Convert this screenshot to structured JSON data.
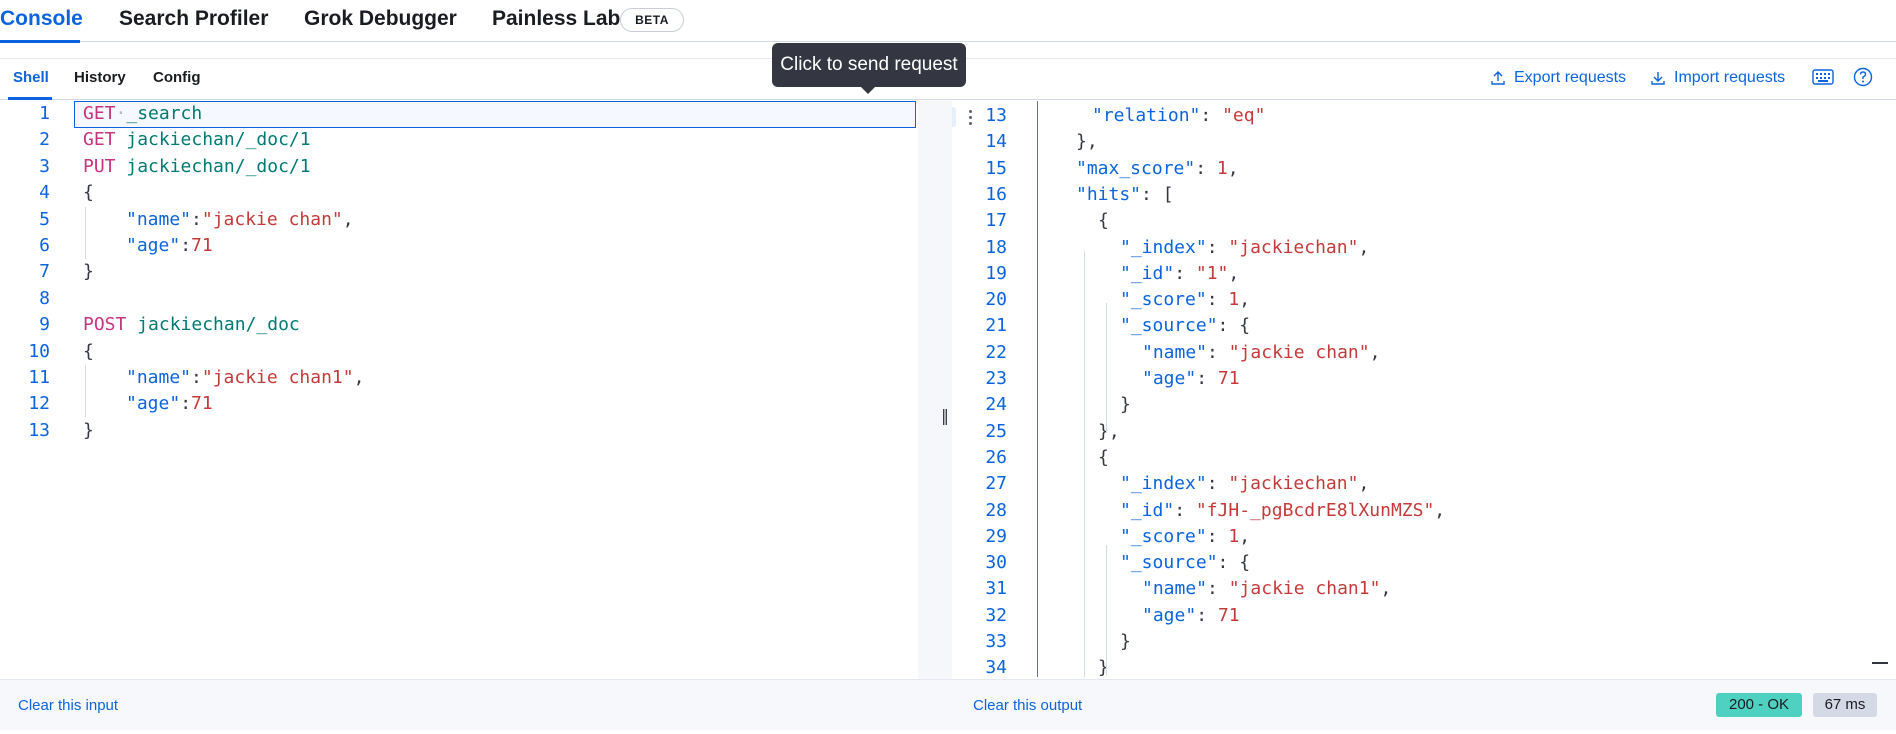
{
  "top_tabs": {
    "console": "Console",
    "search_profiler": "Search Profiler",
    "grok_debugger": "Grok Debugger",
    "painless_lab": "Painless Lab",
    "beta": "BETA"
  },
  "sub_tabs": {
    "shell": "Shell",
    "history": "History",
    "config": "Config"
  },
  "actions": {
    "export": "Export requests",
    "import": "Import requests",
    "keyboard_icon": "keyboard-icon",
    "help_icon": "help-icon"
  },
  "tooltip": "Click to send request",
  "input_lines": [
    {
      "n": "1",
      "method": "GET",
      "path": "_search"
    },
    {
      "n": "2",
      "method": "GET",
      "path": "jackiechan/_doc/1"
    },
    {
      "n": "3",
      "method": "PUT",
      "path": "jackiechan/_doc/1"
    },
    {
      "n": "4",
      "text": "{"
    },
    {
      "n": "5",
      "key": "\"name\"",
      "sep": ":",
      "val": "\"jackie chan\"",
      "tail": ","
    },
    {
      "n": "6",
      "key": "\"age\"",
      "sep": ":",
      "num": "71"
    },
    {
      "n": "7",
      "text": "}"
    },
    {
      "n": "8"
    },
    {
      "n": "9",
      "method": "POST",
      "path": "jackiechan/_doc"
    },
    {
      "n": "10",
      "text": "{"
    },
    {
      "n": "11",
      "key": "\"name\"",
      "sep": ":",
      "val": "\"jackie chan1\"",
      "tail": ","
    },
    {
      "n": "12",
      "key": "\"age\"",
      "sep": ":",
      "num": "71"
    },
    {
      "n": "13",
      "text": "}"
    }
  ],
  "output_lines": [
    {
      "n": "13",
      "key": "\"relation\"",
      "sep": ": ",
      "val": "\"eq\""
    },
    {
      "n": "14",
      "text": "},"
    },
    {
      "n": "15",
      "key": "\"max_score\"",
      "sep": ": ",
      "num": "1",
      "tail": ","
    },
    {
      "n": "16",
      "key": "\"hits\"",
      "sep": ": ",
      "text2": "["
    },
    {
      "n": "17",
      "text": "{"
    },
    {
      "n": "18",
      "key": "\"_index\"",
      "sep": ": ",
      "val": "\"jackiechan\"",
      "tail": ","
    },
    {
      "n": "19",
      "key": "\"_id\"",
      "sep": ": ",
      "val": "\"1\"",
      "tail": ","
    },
    {
      "n": "20",
      "key": "\"_score\"",
      "sep": ": ",
      "num": "1",
      "tail": ","
    },
    {
      "n": "21",
      "key": "\"_source\"",
      "sep": ": ",
      "text2": "{"
    },
    {
      "n": "22",
      "key": "\"name\"",
      "sep": ": ",
      "val": "\"jackie chan\"",
      "tail": ","
    },
    {
      "n": "23",
      "key": "\"age\"",
      "sep": ": ",
      "num": "71"
    },
    {
      "n": "24",
      "text": "}"
    },
    {
      "n": "25",
      "text": "},"
    },
    {
      "n": "26",
      "text": "{"
    },
    {
      "n": "27",
      "key": "\"_index\"",
      "sep": ": ",
      "val": "\"jackiechan\"",
      "tail": ","
    },
    {
      "n": "28",
      "key": "\"_id\"",
      "sep": ": ",
      "val": "\"fJH-_pgBcdrE8lXunMZS\"",
      "tail": ","
    },
    {
      "n": "29",
      "key": "\"_score\"",
      "sep": ": ",
      "num": "1",
      "tail": ","
    },
    {
      "n": "30",
      "key": "\"_source\"",
      "sep": ": ",
      "text2": "{"
    },
    {
      "n": "31",
      "key": "\"name\"",
      "sep": ": ",
      "val": "\"jackie chan1\"",
      "tail": ","
    },
    {
      "n": "32",
      "key": "\"age\"",
      "sep": ": ",
      "num": "71"
    },
    {
      "n": "33",
      "text": "}"
    },
    {
      "n": "34",
      "text": "}"
    }
  ],
  "footer": {
    "clear_input": "Clear this input",
    "clear_output": "Clear this output",
    "status": "200 - OK",
    "time": "67 ms"
  }
}
